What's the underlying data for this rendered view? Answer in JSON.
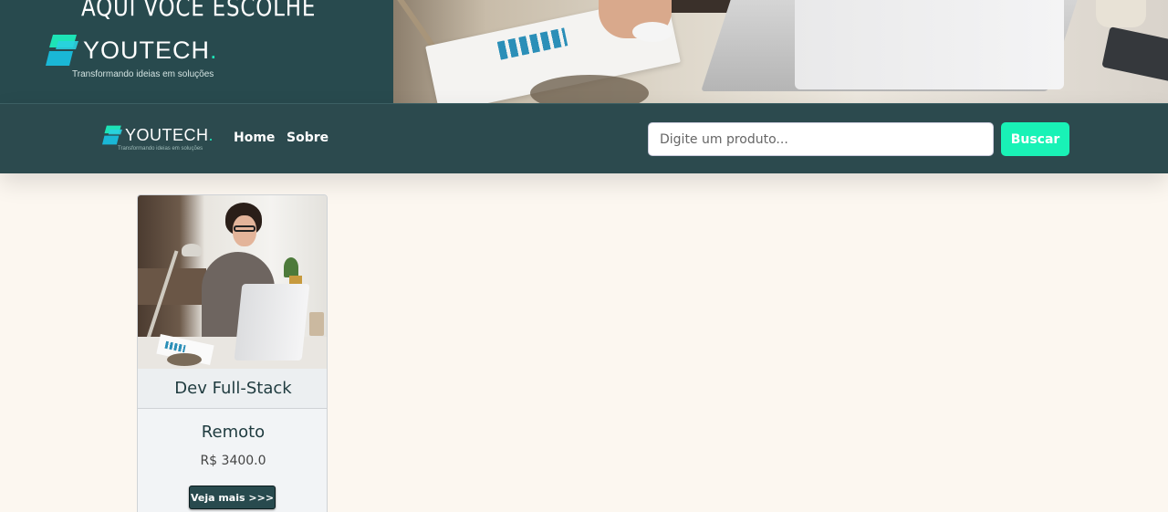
{
  "banner": {
    "slogan": "AQUI VOCÊ ESCOLHE",
    "logo": {
      "brand": "YOUTECH",
      "dot": ".",
      "tagline": "Transformando ideias em soluções"
    }
  },
  "navbar": {
    "logo": {
      "brand": "YOUTECH",
      "dot": ".",
      "tagline": "Transformando ideias em soluções"
    },
    "links": [
      {
        "label": "Home"
      },
      {
        "label": "Sobre"
      }
    ],
    "search": {
      "placeholder": "Digite um produto...",
      "value": ""
    },
    "search_button": "Buscar"
  },
  "products": [
    {
      "title": "Dev Full-Stack",
      "mode": "Remoto",
      "price": "R$ 3400.0",
      "button": "Veja mais >>>"
    }
  ],
  "colors": {
    "primary": "#2c4a4e",
    "accent": "#19f2b6",
    "background": "#fcf7f0"
  },
  "icons": {
    "logo_mark": "youtech-logo-icon"
  }
}
